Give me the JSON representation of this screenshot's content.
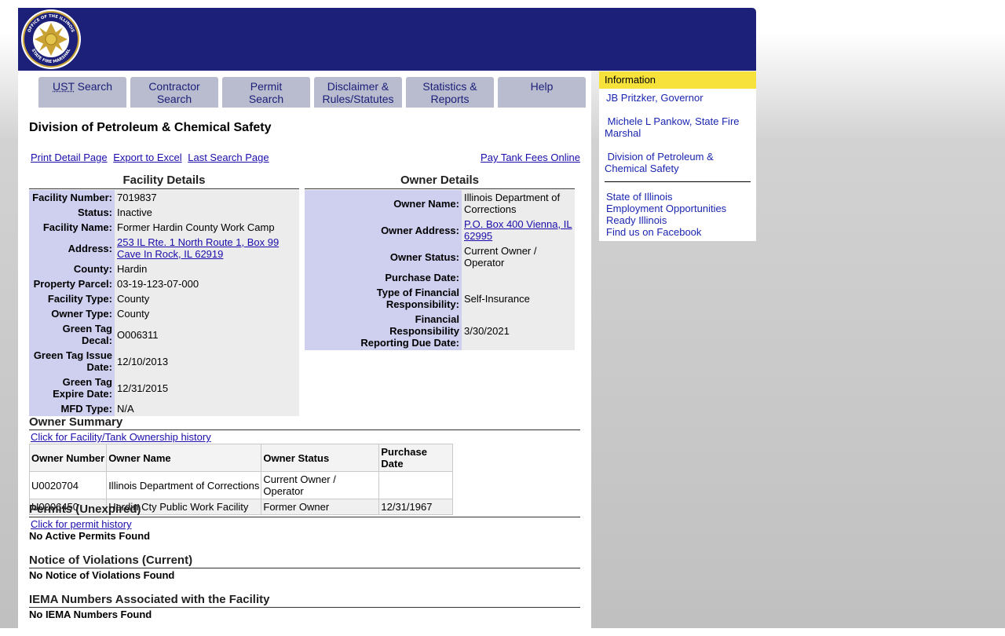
{
  "tabs": [
    {
      "abbr": "UST",
      "rest": " Search"
    },
    {
      "label": "Contractor Search"
    },
    {
      "label": "Permit Search"
    },
    {
      "label": "Disclaimer & Rules/Statutes"
    },
    {
      "label": "Statistics & Reports"
    },
    {
      "label": "Help"
    }
  ],
  "page_title": "Division of Petroleum & Chemical Safety",
  "links": {
    "print": "Print Detail Page",
    "export": "Export to Excel",
    "last_search": "Last Search Page",
    "pay": "Pay Tank Fees Online"
  },
  "facility": {
    "heading": "Facility Details",
    "rows": [
      {
        "label": "Facility Number:",
        "value": "7019837"
      },
      {
        "label": "Status:",
        "value": "Inactive"
      },
      {
        "label": "Facility Name:",
        "value": "Former Hardin County Work Camp"
      },
      {
        "label": "Address:",
        "value_line1": "253 IL Rte. 1 North Route 1, Box 99",
        "value_line2": "Cave In Rock, IL 62919"
      },
      {
        "label": "County:",
        "value": "Hardin"
      },
      {
        "label": "Property Parcel:",
        "value": "03-19-123-07-000"
      },
      {
        "label": "Facility Type:",
        "value": "County"
      },
      {
        "label": "Owner Type:",
        "value": "County"
      },
      {
        "label": "Green Tag Decal:",
        "value": "O006311"
      },
      {
        "label": "Green Tag Issue Date:",
        "value": "12/10/2013"
      },
      {
        "label": "Green Tag Expire Date:",
        "value": "12/31/2015"
      },
      {
        "label": "MFD Type:",
        "value": "N/A"
      }
    ]
  },
  "owner": {
    "heading": "Owner Details",
    "rows": [
      {
        "label": "Owner Name:",
        "value": "Illinois Department of Corrections"
      },
      {
        "label": "Owner Address:",
        "value": "P.O. Box 400 Vienna, IL 62995"
      },
      {
        "label": "Owner Status:",
        "value": "Current Owner / Operator"
      },
      {
        "label": "Purchase Date:",
        "value": ""
      },
      {
        "label": "Type of Financial Responsibility:",
        "value": "Self-Insurance"
      },
      {
        "label": "Financial Responsibility Reporting Due Date:",
        "value": "3/30/2021"
      }
    ]
  },
  "owner_summary": {
    "title": "Owner Summary",
    "link": "Click for Facility/Tank Ownership history",
    "columns": [
      "Owner Number",
      "Owner Name",
      "Owner Status",
      "Purchase Date"
    ],
    "rows": [
      [
        "U0020704",
        "Illinois Department of Corrections",
        "Current Owner / Operator",
        ""
      ],
      [
        "U0006450",
        "Hardin Cty Public Work Facility",
        "Former Owner",
        "12/31/1967"
      ]
    ]
  },
  "permits": {
    "title": "Permits (Unexpired)",
    "link": "Click for permit history",
    "none": "No Active Permits Found"
  },
  "violations": {
    "title": "Notice of Violations (Current)",
    "none": "No Notice of Violations Found"
  },
  "iema": {
    "title": "IEMA Numbers Associated with the Facility",
    "none": "No IEMA Numbers Found"
  },
  "sidebar": {
    "heading": "Information",
    "group1": [
      "JB Pritzker, Governor",
      "Michele L Pankow, State Fire Marshal",
      "Division of Petroleum & Chemical Safety"
    ],
    "group2": [
      "State of Illinois",
      "Employment Opportunities",
      "Ready Illinois",
      "Find us on Facebook"
    ]
  },
  "seal_text": "OFFICE OF THE ILLINOIS STATE FIRE MARSHAL",
  "colors": {
    "header_bg": "#1c2078",
    "tab_bg": "#b9bbcf",
    "label_bg": "#cfd0f0",
    "value_bg": "#ececec",
    "sidebar_head": "#f7e23c"
  }
}
